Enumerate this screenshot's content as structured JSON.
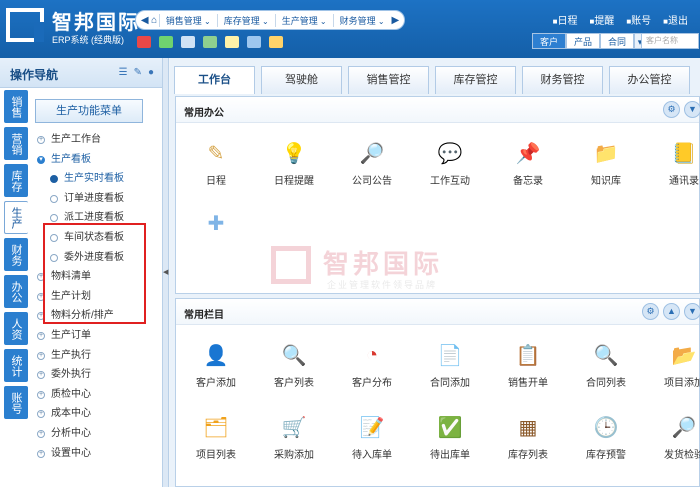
{
  "app": {
    "logo_title": "智邦国际",
    "logo_sub": "ERP系统 (经典版)"
  },
  "topnav": {
    "items": [
      "销售管理",
      "库存管理",
      "生产管理",
      "财务管理"
    ]
  },
  "topright": {
    "items": [
      "日程",
      "提醒",
      "账号",
      "退出"
    ]
  },
  "quicktabs": {
    "items": [
      "客户",
      "产品",
      "合同"
    ],
    "active": "客户",
    "search_placeholder": "客户名称"
  },
  "leftnav": {
    "title": "操作导航",
    "vtabs": [
      "销售",
      "营销",
      "库存",
      "生产",
      "财务",
      "办公",
      "人资",
      "统计",
      "账号"
    ],
    "active_vtab": "生产",
    "menu_button": "生产功能菜单",
    "tree": [
      {
        "label": "生产工作台",
        "level": 1
      },
      {
        "label": "生产看板",
        "level": 1,
        "open": true
      },
      {
        "label": "生产实时看板",
        "level": 2,
        "active": true
      },
      {
        "label": "订单进度看板",
        "level": 2
      },
      {
        "label": "派工进度看板",
        "level": 2
      },
      {
        "label": "车间状态看板",
        "level": 2
      },
      {
        "label": "委外进度看板",
        "level": 2
      },
      {
        "label": "物料清单",
        "level": 1
      },
      {
        "label": "生产计划",
        "level": 1
      },
      {
        "label": "物料分析/排产",
        "level": 1
      },
      {
        "label": "生产订单",
        "level": 1
      },
      {
        "label": "生产执行",
        "level": 1
      },
      {
        "label": "委外执行",
        "level": 1
      },
      {
        "label": "质检中心",
        "level": 1
      },
      {
        "label": "成本中心",
        "level": 1
      },
      {
        "label": "分析中心",
        "level": 1
      },
      {
        "label": "设置中心",
        "level": 1
      }
    ]
  },
  "main": {
    "tabs": [
      "工作台",
      "驾驶舱",
      "销售管控",
      "库存管控",
      "财务管控",
      "办公管控"
    ],
    "active_tab": "工作台",
    "panel1": {
      "title": "常用办公",
      "items": [
        {
          "label": "日程",
          "icon": "pencil-icon",
          "color": "#d6a54a"
        },
        {
          "label": "日程提醒",
          "icon": "bulb-icon",
          "color": "#f2c200"
        },
        {
          "label": "公司公告",
          "icon": "magnifier-doc-icon",
          "color": "#8a9fb3"
        },
        {
          "label": "工作互动",
          "icon": "chat-icon",
          "color": "#6f8aa6"
        },
        {
          "label": "备忘录",
          "icon": "pin-icon",
          "color": "#d9382f"
        },
        {
          "label": "知识库",
          "icon": "folder-icon",
          "color": "#f0a21c"
        },
        {
          "label": "通讯录",
          "icon": "address-book-icon",
          "color": "#8b5a2b"
        },
        {
          "label": "",
          "icon": "add-icon",
          "color": "#7fb4e6"
        }
      ]
    },
    "panel2": {
      "title": "常用栏目",
      "items": [
        {
          "label": "客户添加",
          "icon": "user-add-icon",
          "color": "#3e9a3a"
        },
        {
          "label": "客户列表",
          "icon": "search-list-icon",
          "color": "#c9a13a"
        },
        {
          "label": "客户分布",
          "icon": "pie-chart-icon",
          "color": "#d9382f"
        },
        {
          "label": "合同添加",
          "icon": "doc-add-icon",
          "color": "#3e9a3a"
        },
        {
          "label": "销售开单",
          "icon": "clipboard-icon",
          "color": "#8b5a2b"
        },
        {
          "label": "合同列表",
          "icon": "magnifier-icon",
          "color": "#5a86b5"
        },
        {
          "label": "项目添加",
          "icon": "folder-add-icon",
          "color": "#f0a21c"
        },
        {
          "label": "项目列表",
          "icon": "folder-search-icon",
          "color": "#f0a21c"
        },
        {
          "label": "采购添加",
          "icon": "cart-icon",
          "color": "#3e9a3a"
        },
        {
          "label": "待入库单",
          "icon": "doc-edit-icon",
          "color": "#d9382f"
        },
        {
          "label": "待出库单",
          "icon": "doc-check-icon",
          "color": "#4a78b0"
        },
        {
          "label": "库存列表",
          "icon": "abacus-icon",
          "color": "#8b5a2b"
        },
        {
          "label": "库存预警",
          "icon": "clock-icon",
          "color": "#2b7fcf"
        },
        {
          "label": "发货检验",
          "icon": "search-user-icon",
          "color": "#6f8aa6"
        }
      ]
    },
    "watermark": {
      "title": "智邦国际",
      "sub": "企业管理软件领导品牌"
    }
  }
}
